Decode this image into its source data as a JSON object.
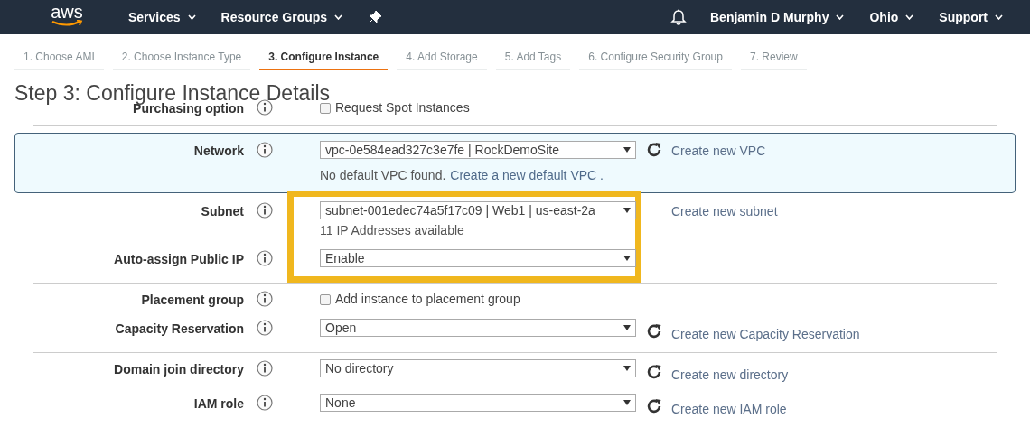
{
  "nav": {
    "logo": "aws",
    "left": [
      {
        "kind": "menu",
        "label": "Services"
      },
      {
        "kind": "menu",
        "label": "Resource Groups"
      },
      {
        "kind": "pin"
      }
    ],
    "right": [
      {
        "kind": "bell"
      },
      {
        "kind": "menu",
        "label": "Benjamin D Murphy"
      },
      {
        "kind": "menu",
        "label": "Ohio"
      },
      {
        "kind": "menu",
        "label": "Support"
      }
    ]
  },
  "tabs": [
    {
      "label": "1. Choose AMI",
      "selected": false
    },
    {
      "label": "2. Choose Instance Type",
      "selected": false
    },
    {
      "label": "3. Configure Instance",
      "selected": true
    },
    {
      "label": "4. Add Storage",
      "selected": false
    },
    {
      "label": "5. Add Tags",
      "selected": false
    },
    {
      "label": "6. Configure Security Group",
      "selected": false
    },
    {
      "label": "7. Review",
      "selected": false
    }
  ],
  "heading": "Step 3: Configure Instance Details",
  "groups": [
    {
      "kind": "plain",
      "divider": true,
      "rows": [
        {
          "label": "Purchasing option",
          "kind": "checkbox",
          "value": "Request Spot Instances",
          "checked": false
        }
      ]
    },
    {
      "kind": "focus",
      "divider": false,
      "rows": [
        {
          "label": "Network",
          "kind": "select",
          "value": "vpc-0e584ead327c3e7fe | RockDemoSite",
          "refresh": true,
          "link": "Create new VPC",
          "helper": "No default VPC found.",
          "helper_link": "Create a new default VPC ."
        }
      ]
    },
    {
      "kind": "callout",
      "divider": true,
      "rows": [
        {
          "label": "Subnet",
          "kind": "select",
          "value": "subnet-001edec74a5f17c09 | Web1 | us-east-2a",
          "refresh": false,
          "link": "Create new subnet",
          "helper": "11 IP Addresses available"
        },
        {
          "label": "Auto-assign Public IP",
          "kind": "select",
          "value": "Enable",
          "refresh": false
        }
      ]
    },
    {
      "kind": "plain",
      "divider": true,
      "rows": [
        {
          "label": "Placement group",
          "kind": "checkbox",
          "value": "Add instance to placement group",
          "checked": false
        },
        {
          "label": "Capacity Reservation",
          "kind": "select",
          "value": "Open",
          "refresh": true,
          "link": "Create new Capacity Reservation"
        }
      ]
    },
    {
      "kind": "plain",
      "divider": false,
      "rows": [
        {
          "label": "Domain join directory",
          "kind": "select",
          "value": "No directory",
          "refresh": true,
          "link": "Create new directory"
        },
        {
          "label": "IAM role",
          "kind": "select",
          "value": "None",
          "refresh": true,
          "link": "Create new IAM role"
        }
      ]
    }
  ]
}
